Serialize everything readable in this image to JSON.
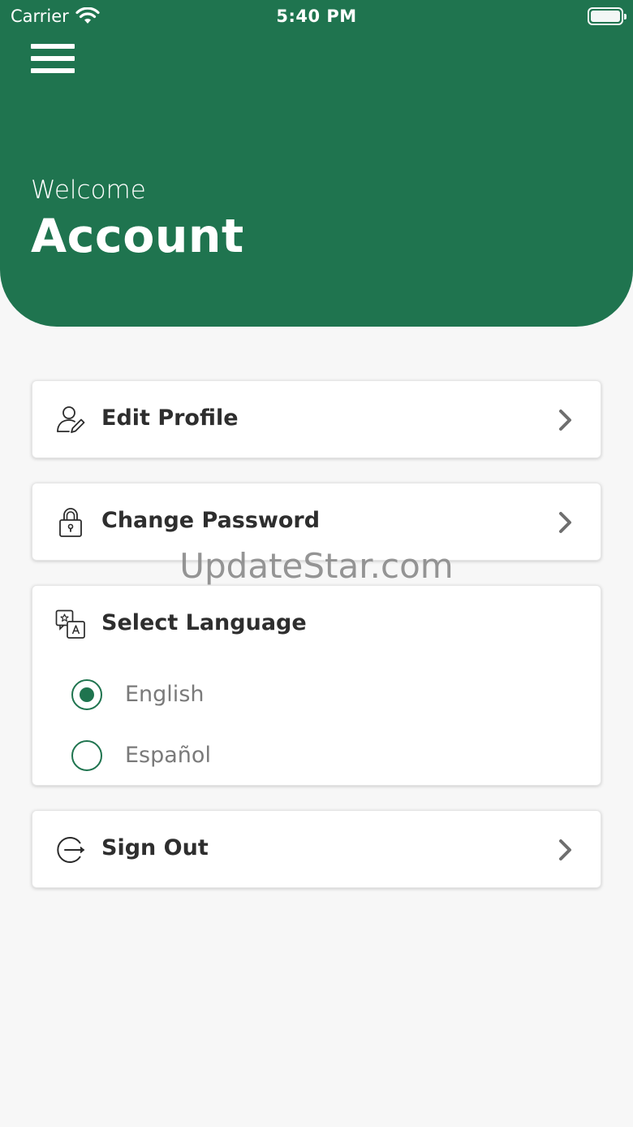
{
  "status_bar": {
    "carrier": "Carrier",
    "time": "5:40 PM"
  },
  "header": {
    "welcome": "Welcome",
    "title": "Account",
    "background_color": "#1f744f"
  },
  "menu": {
    "edit_profile": "Edit Profile",
    "change_password": "Change Password",
    "select_language": "Select Language",
    "sign_out": "Sign Out"
  },
  "language_options": [
    {
      "label": "English",
      "selected": true
    },
    {
      "label": "Español",
      "selected": false
    }
  ],
  "watermark": "UpdateStar.com",
  "icons": {
    "menu": "hamburger-menu-icon",
    "edit_profile": "user-edit-icon",
    "change_password": "lock-icon",
    "select_language": "translate-icon",
    "sign_out": "sign-out-icon",
    "chevron": "chevron-right-icon"
  }
}
